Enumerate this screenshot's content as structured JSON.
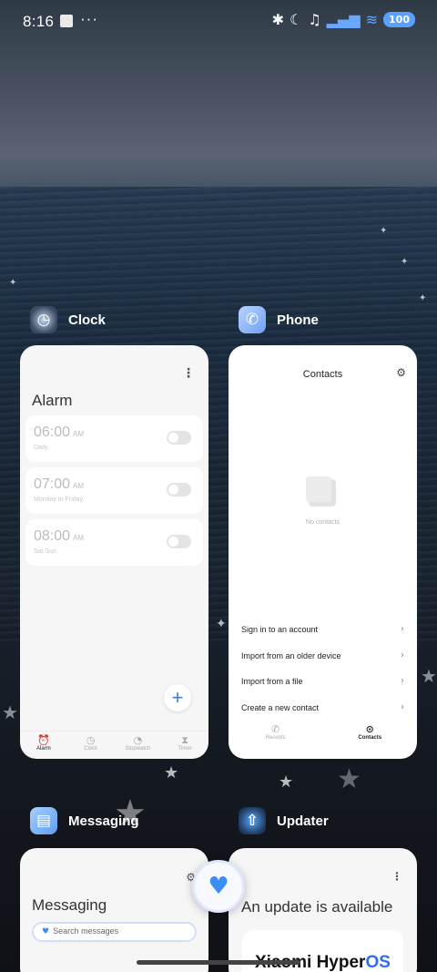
{
  "status_bar": {
    "time": "8:16",
    "dots": "···",
    "battery": "100"
  },
  "apps": {
    "clock": {
      "name": "Clock",
      "icon": "clock-app-icon",
      "screen_title": "Alarm",
      "alarms": [
        {
          "time": "06:00",
          "ampm": "AM",
          "repeat": "Daily"
        },
        {
          "time": "07:00",
          "ampm": "AM",
          "repeat": "Monday to Friday"
        },
        {
          "time": "08:00",
          "ampm": "AM",
          "repeat": "Sat Sun"
        }
      ],
      "fab": "+",
      "nav": [
        {
          "label": "Alarm",
          "icon": "alarm-icon"
        },
        {
          "label": "Clock",
          "icon": "clock-icon"
        },
        {
          "label": "Stopwatch",
          "icon": "stopwatch-icon"
        },
        {
          "label": "Timer",
          "icon": "timer-icon"
        }
      ]
    },
    "phone": {
      "name": "Phone",
      "icon": "phone-app-icon",
      "screen_title": "Contacts",
      "empty_text": "No contacts",
      "actions": [
        "Sign in to an account",
        "Import from an older device",
        "Import from a file",
        "Create a new contact"
      ],
      "nav": [
        {
          "label": "Recents",
          "icon": "recents-icon"
        },
        {
          "label": "Contacts",
          "icon": "contacts-icon"
        }
      ]
    },
    "messaging": {
      "name": "Messaging",
      "icon": "messaging-app-icon",
      "screen_title": "Messaging",
      "search_placeholder": "Search messages"
    },
    "updater": {
      "name": "Updater",
      "icon": "updater-app-icon",
      "screen_title": "An update is available",
      "brand": "Xiaomi Hyper",
      "brand_os": "OS"
    }
  },
  "colors": {
    "accent": "#2f7ef5",
    "heart": "#3b8df6"
  }
}
